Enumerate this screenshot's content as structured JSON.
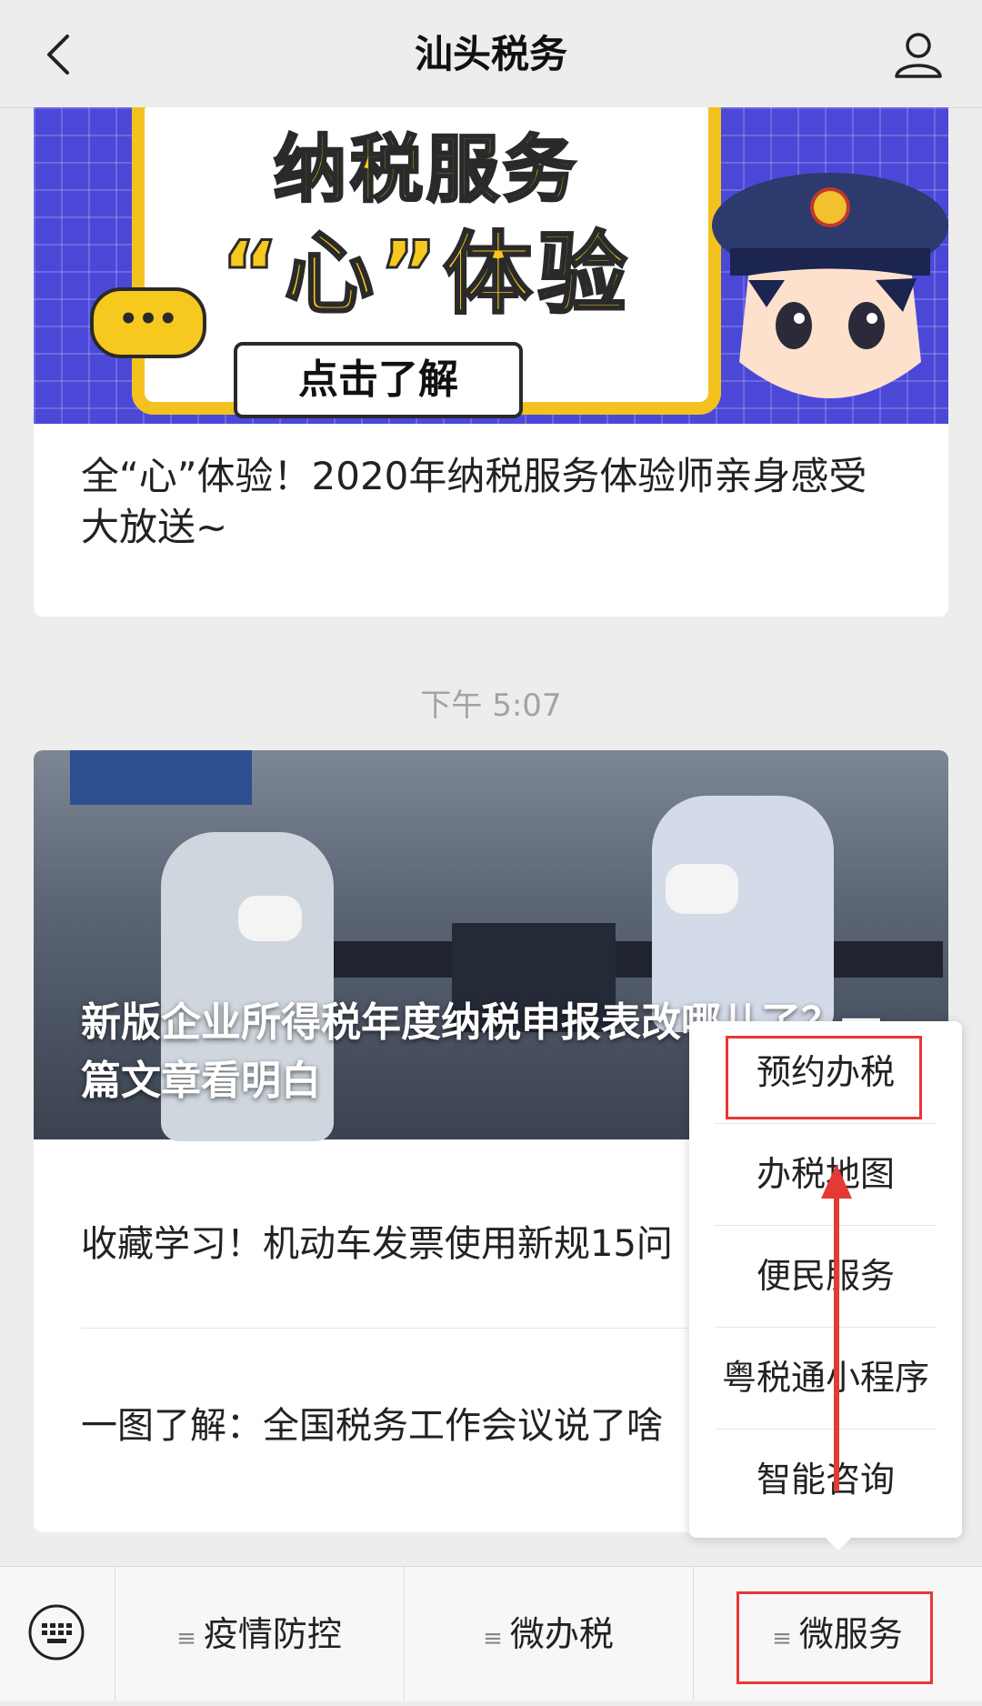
{
  "header": {
    "title": "汕头税务"
  },
  "article1": {
    "banner_line1": "纳税服务",
    "banner_line2": "“心”体验",
    "banner_cta": "点击了解",
    "banner_bubble": "•••",
    "title": "全“心”体验！2020年纳税服务体验师亲身感受大放送~"
  },
  "timestamp": "下午 5:07",
  "article2": {
    "caption": "新版企业所得税年度纳税申报表改哪儿了？一篇文章看明白",
    "items": [
      "收藏学习！机动车发票使用新规15问",
      "一图了解：全国税务工作会议说了啥"
    ]
  },
  "popup_menu": {
    "items": [
      "预约办税",
      "办税地图",
      "便民服务",
      "粤税通小程序",
      "智能咨询"
    ]
  },
  "bottom_menu": {
    "items": [
      "疫情防控",
      "微办税",
      "微服务"
    ]
  },
  "colors": {
    "banner_blue": "#4b48d8",
    "banner_yellow": "#f7c81e",
    "highlight_red": "#e53935"
  }
}
